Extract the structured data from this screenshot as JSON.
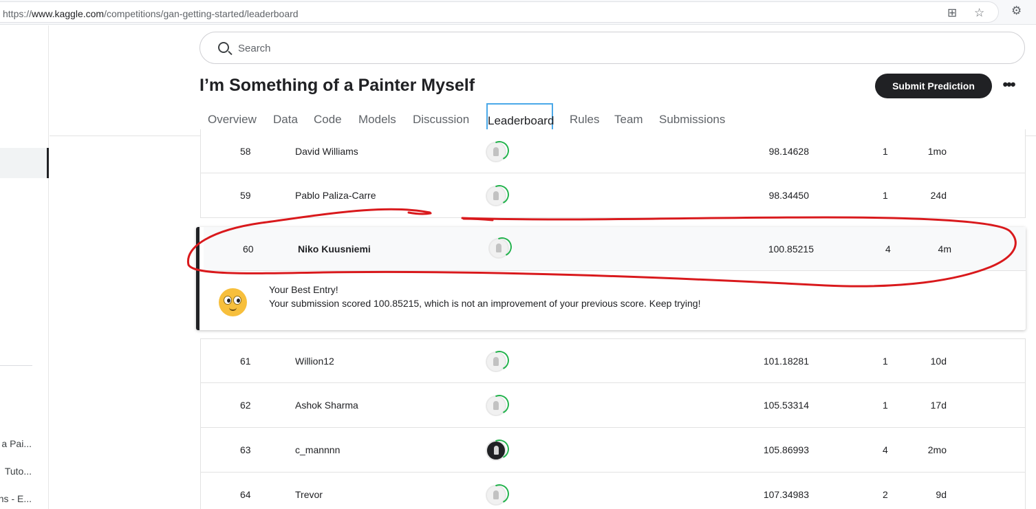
{
  "browser": {
    "url_prefix": "https://",
    "url_host": "www.kaggle.com",
    "url_path": "/competitions/gan-getting-started/leaderboard"
  },
  "sidebar": {
    "items": [
      {
        "label": "a Pai..."
      },
      {
        "label": "Tuto..."
      },
      {
        "label": "ns - E..."
      }
    ]
  },
  "search": {
    "placeholder": "Search"
  },
  "competition": {
    "title": "I’m Something of a Painter Myself"
  },
  "actions": {
    "submit_label": "Submit Prediction",
    "more_label": "•••"
  },
  "tabs": [
    {
      "label": "Overview"
    },
    {
      "label": "Data"
    },
    {
      "label": "Code"
    },
    {
      "label": "Models"
    },
    {
      "label": "Discussion"
    },
    {
      "label": "Leaderboard"
    },
    {
      "label": "Rules"
    },
    {
      "label": "Team"
    },
    {
      "label": "Submissions"
    }
  ],
  "leaderboard": {
    "rows_before": [
      {
        "rank": "58",
        "name": "David Williams",
        "score": "98.14628",
        "entries": "1",
        "last": "1mo"
      },
      {
        "rank": "59",
        "name": "Pablo Paliza-Carre",
        "score": "98.34450",
        "entries": "1",
        "last": "24d"
      }
    ],
    "own": {
      "rank": "60",
      "name": "Niko Kuusniemi",
      "score": "100.85215",
      "entries": "4",
      "last": "4m"
    },
    "rows_after": [
      {
        "rank": "61",
        "name": "Willion12",
        "score": "101.18281",
        "entries": "1",
        "last": "10d"
      },
      {
        "rank": "62",
        "name": "Ashok Sharma",
        "score": "105.53314",
        "entries": "1",
        "last": "17d"
      },
      {
        "rank": "63",
        "name": "c_mannnn",
        "score": "105.86993",
        "entries": "4",
        "last": "2mo"
      },
      {
        "rank": "64",
        "name": "Trevor",
        "score": "107.34983",
        "entries": "2",
        "last": "9d"
      }
    ]
  },
  "message": {
    "title": "Your Best Entry!",
    "body": "Your submission scored 100.85215, which is not an improvement of your previous score. Keep trying!"
  },
  "colors": {
    "annotation": "#d9191c",
    "accent_tab_border": "#4aa8e8",
    "progress_ring": "#22b24c"
  }
}
